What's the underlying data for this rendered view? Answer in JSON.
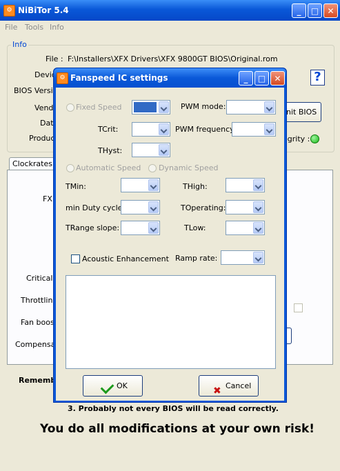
{
  "window": {
    "title": "NiBiTor 5.4",
    "min": "_",
    "max": "□",
    "close": "✕"
  },
  "menu": [
    "File",
    "Tools",
    "Info"
  ],
  "info": {
    "legend": "Info",
    "file_label": "File :",
    "file_value": "F:\\Installers\\XFX Drivers\\XFX 9800GT BIOS\\Original.rom",
    "device_label": "Devic",
    "bios_version_label": "BIOS Versic",
    "vendor_label": "Vend",
    "date_label": "Dat",
    "product_label": "Produc",
    "edit_bios_label": "Init BIOS",
    "integrity_label": "egrity :",
    "help_label": "?"
  },
  "tabs": {
    "clockrates": "Clockrates"
  },
  "panel_labels": {
    "fx": "FX",
    "critical": "Critical",
    "throttling": "Throttling",
    "fan_boost": "Fan boost",
    "compensat": "Compensat"
  },
  "bottom": {
    "remember": "Remembe",
    "note3": "3. Probably not every BIOS will be read correctly.",
    "warning": "You do all modifications at your own risk!"
  },
  "dialog": {
    "title": "Fanspeed IC settings",
    "fixed_speed": "Fixed Speed",
    "pwm_mode": "PWM mode:",
    "tcrit": "TCrit:",
    "pwm_frequency": "PWM frequency:",
    "thyst": "THyst:",
    "automatic_speed": "Automatic Speed",
    "dynamic_speed": "Dynamic Speed",
    "tmin": "TMin:",
    "thigh": "THigh:",
    "min_duty_cycle": "min Duty cycle:",
    "toperating": "TOperating:",
    "trange_slope": "TRange slope:",
    "tlow": "TLow:",
    "acoustic_enhancement": "Acoustic Enhancement",
    "ramp_rate": "Ramp rate:",
    "ok": "OK",
    "cancel": "Cancel"
  }
}
